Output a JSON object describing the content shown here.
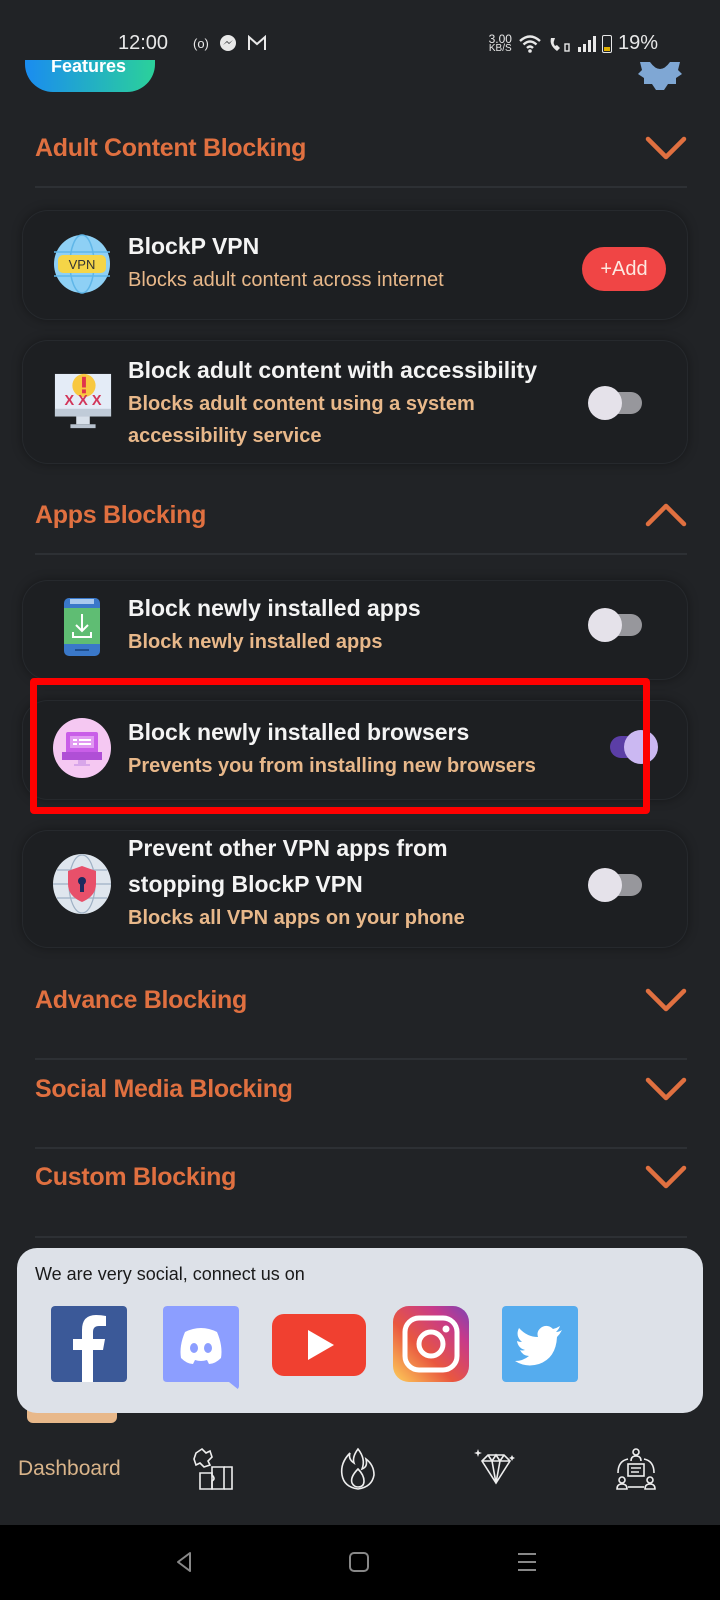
{
  "status_bar": {
    "time": "12:00",
    "left_icons": [
      "hotspot-icon",
      "messenger-icon",
      "gmail-icon"
    ],
    "net_speed_value": "3.00",
    "net_speed_unit": "KB/S",
    "battery_percent": "19%"
  },
  "header": {
    "features_tab_label": "Features",
    "settings_icon": "gear-icon"
  },
  "sections": {
    "adult": {
      "title": "Adult Content Blocking",
      "expanded": false
    },
    "apps": {
      "title": "Apps Blocking",
      "expanded": true
    },
    "advance": {
      "title": "Advance Blocking",
      "expanded": false
    },
    "social": {
      "title": "Social Media Blocking",
      "expanded": false
    },
    "custom": {
      "title": "Custom Blocking",
      "expanded": false
    }
  },
  "cards": {
    "vpn": {
      "title": "BlockP VPN",
      "subtitle": "Blocks adult content across internet",
      "button": "+Add",
      "icon_text": "VPN"
    },
    "accessibility": {
      "title": "Block adult content with accessibility",
      "subtitle_line1": "Blocks adult content using a system",
      "subtitle_line2": "accessibility service",
      "enabled": false
    },
    "new_apps": {
      "title": "Block newly installed apps",
      "subtitle": "Block newly installed apps",
      "enabled": false
    },
    "new_browsers": {
      "title": "Block newly installed browsers",
      "subtitle": "Prevents you from installing new browsers",
      "enabled": true
    },
    "vpn_protect": {
      "title_line1": "Prevent other VPN apps from",
      "title_line2": "stopping BlockP VPN",
      "subtitle": "Blocks all VPN apps on your phone",
      "enabled": false
    }
  },
  "social_panel": {
    "label": "We are very social, connect us on",
    "links": [
      "Facebook",
      "Discord",
      "YouTube",
      "Instagram",
      "Twitter"
    ]
  },
  "bottom_nav": {
    "active_label": "Dashboard",
    "items": [
      "Dashboard",
      "puzzle-icon",
      "fire-icon",
      "diamond-icon",
      "community-icon"
    ]
  },
  "colors": {
    "accent_orange": "#e07040",
    "subtitle_tan": "#e8b88a",
    "add_red": "#f04545",
    "toggle_on": "#5b3ea6",
    "highlight": "#ff0000"
  }
}
